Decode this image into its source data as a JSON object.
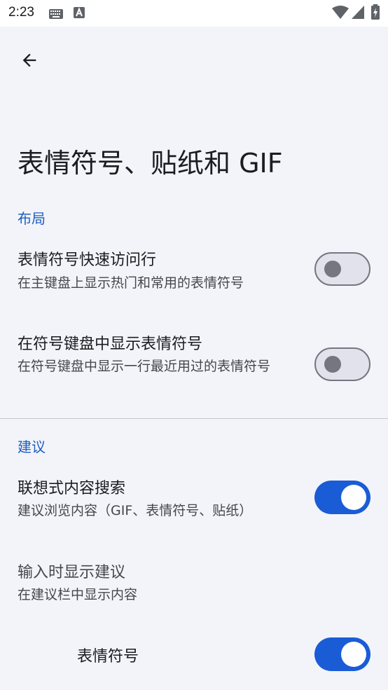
{
  "status_bar": {
    "time": "2:23"
  },
  "header": {
    "back_icon": "arrow-back-icon",
    "title": "表情符号、贴纸和 GIF"
  },
  "sections": {
    "layout": {
      "header": "布局",
      "emoji_row": {
        "title": "表情符号快速访问行",
        "summary": "在主键盘上显示热门和常用的表情符号",
        "enabled": false
      },
      "emoji_in_symbols": {
        "title": "在符号键盘中显示表情符号",
        "summary": "在符号键盘中显示一行最近用过的表情符号",
        "enabled": false
      }
    },
    "suggestions": {
      "header": "建议",
      "content_search": {
        "title": "联想式内容搜索",
        "summary": "建议浏览内容（GIF、表情符号、贴纸）",
        "enabled": true
      },
      "show_while_typing": {
        "title": "输入时显示建议",
        "summary": "在建议栏中显示内容"
      },
      "emoji": {
        "title": "表情符号",
        "enabled": true
      }
    }
  },
  "colors": {
    "accent": "#1a5cd6",
    "section_header": "#1f5fbf",
    "background": "#f2f4fa"
  }
}
